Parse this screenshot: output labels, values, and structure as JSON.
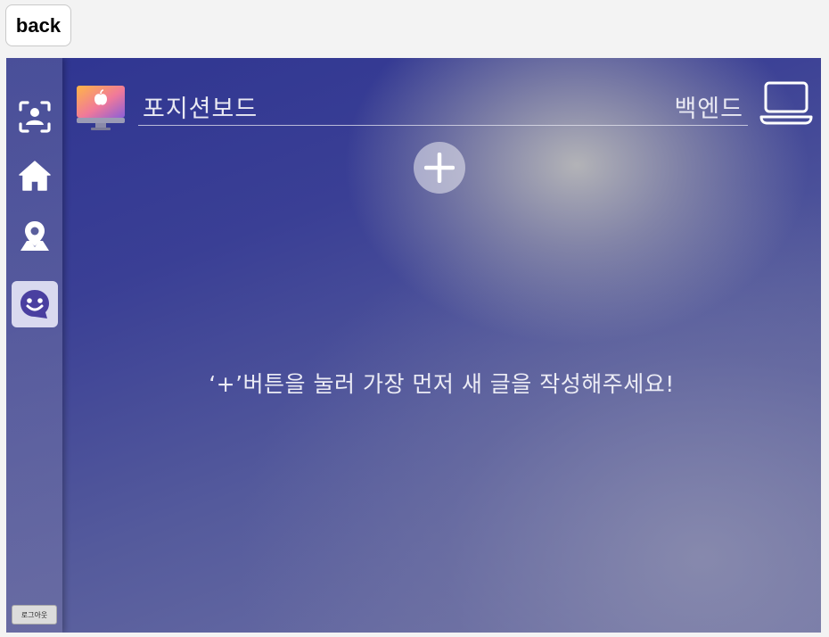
{
  "back_button": {
    "label": "back"
  },
  "sidebar": {
    "items": [
      {
        "icon": "face-scan-icon",
        "active": false
      },
      {
        "icon": "home-icon",
        "active": false
      },
      {
        "icon": "map-pin-icon",
        "active": false
      },
      {
        "icon": "smile-chat-icon",
        "active": true
      }
    ],
    "logout_label": "로그아웃"
  },
  "header": {
    "left_title": "포지션보드",
    "right_title": "백엔드",
    "left_icon": "imac-icon",
    "right_icon": "laptop-icon"
  },
  "add_button": {
    "icon": "plus-icon"
  },
  "empty_state": {
    "message": "‘+’버튼을 눌러 가장 먼저 새 글을 작성해주세요!"
  },
  "colors": {
    "background_deep": "#2f3591",
    "background_light": "#b9b9b9",
    "text_light": "#e9e9f3",
    "active_tab": "#d9d9ef",
    "active_icon": "#4a3fa0"
  }
}
